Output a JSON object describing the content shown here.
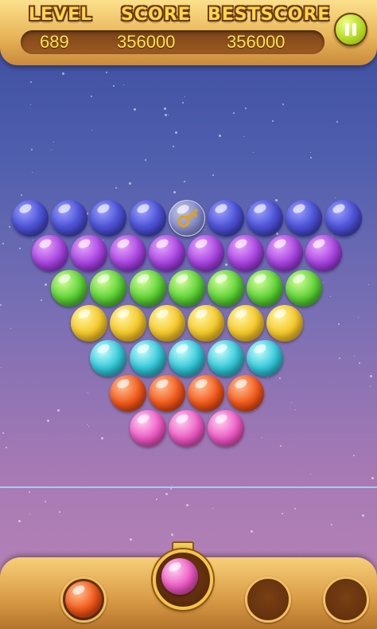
{
  "header": {
    "level_label": "LEVEL",
    "score_label": "SCORE",
    "bestscore_label": "BESTSCORE",
    "level_value": "689",
    "score_value": "356000",
    "bestscore_value": "356000"
  },
  "colors": {
    "navy": "#4f55d6",
    "purple": "#a845e0",
    "green": "#5fd337",
    "yellow": "#f4c92a",
    "cyan": "#35c8d8",
    "orange": "#f25a1a",
    "pink": "#ec5cc4"
  },
  "board": {
    "rows": [
      [
        "navy",
        "navy",
        "navy",
        "navy",
        "key",
        "navy",
        "navy",
        "navy",
        "navy"
      ],
      [
        "purple",
        "purple",
        "purple",
        "purple",
        "purple",
        "purple",
        "purple",
        "purple"
      ],
      [
        "green",
        "green",
        "green",
        "green",
        "green",
        "green",
        "green"
      ],
      [
        "yellow",
        "yellow",
        "yellow",
        "yellow",
        "yellow",
        "yellow"
      ],
      [
        "cyan",
        "cyan",
        "cyan",
        "cyan",
        "cyan"
      ],
      [
        "orange",
        "orange",
        "orange",
        "orange"
      ],
      [
        "pink",
        "pink",
        "pink"
      ]
    ]
  },
  "launcher": {
    "current_bubble": "pink",
    "next_bubble": "orange"
  },
  "icons": {
    "pause": "pause-icon",
    "key": "key-icon"
  }
}
